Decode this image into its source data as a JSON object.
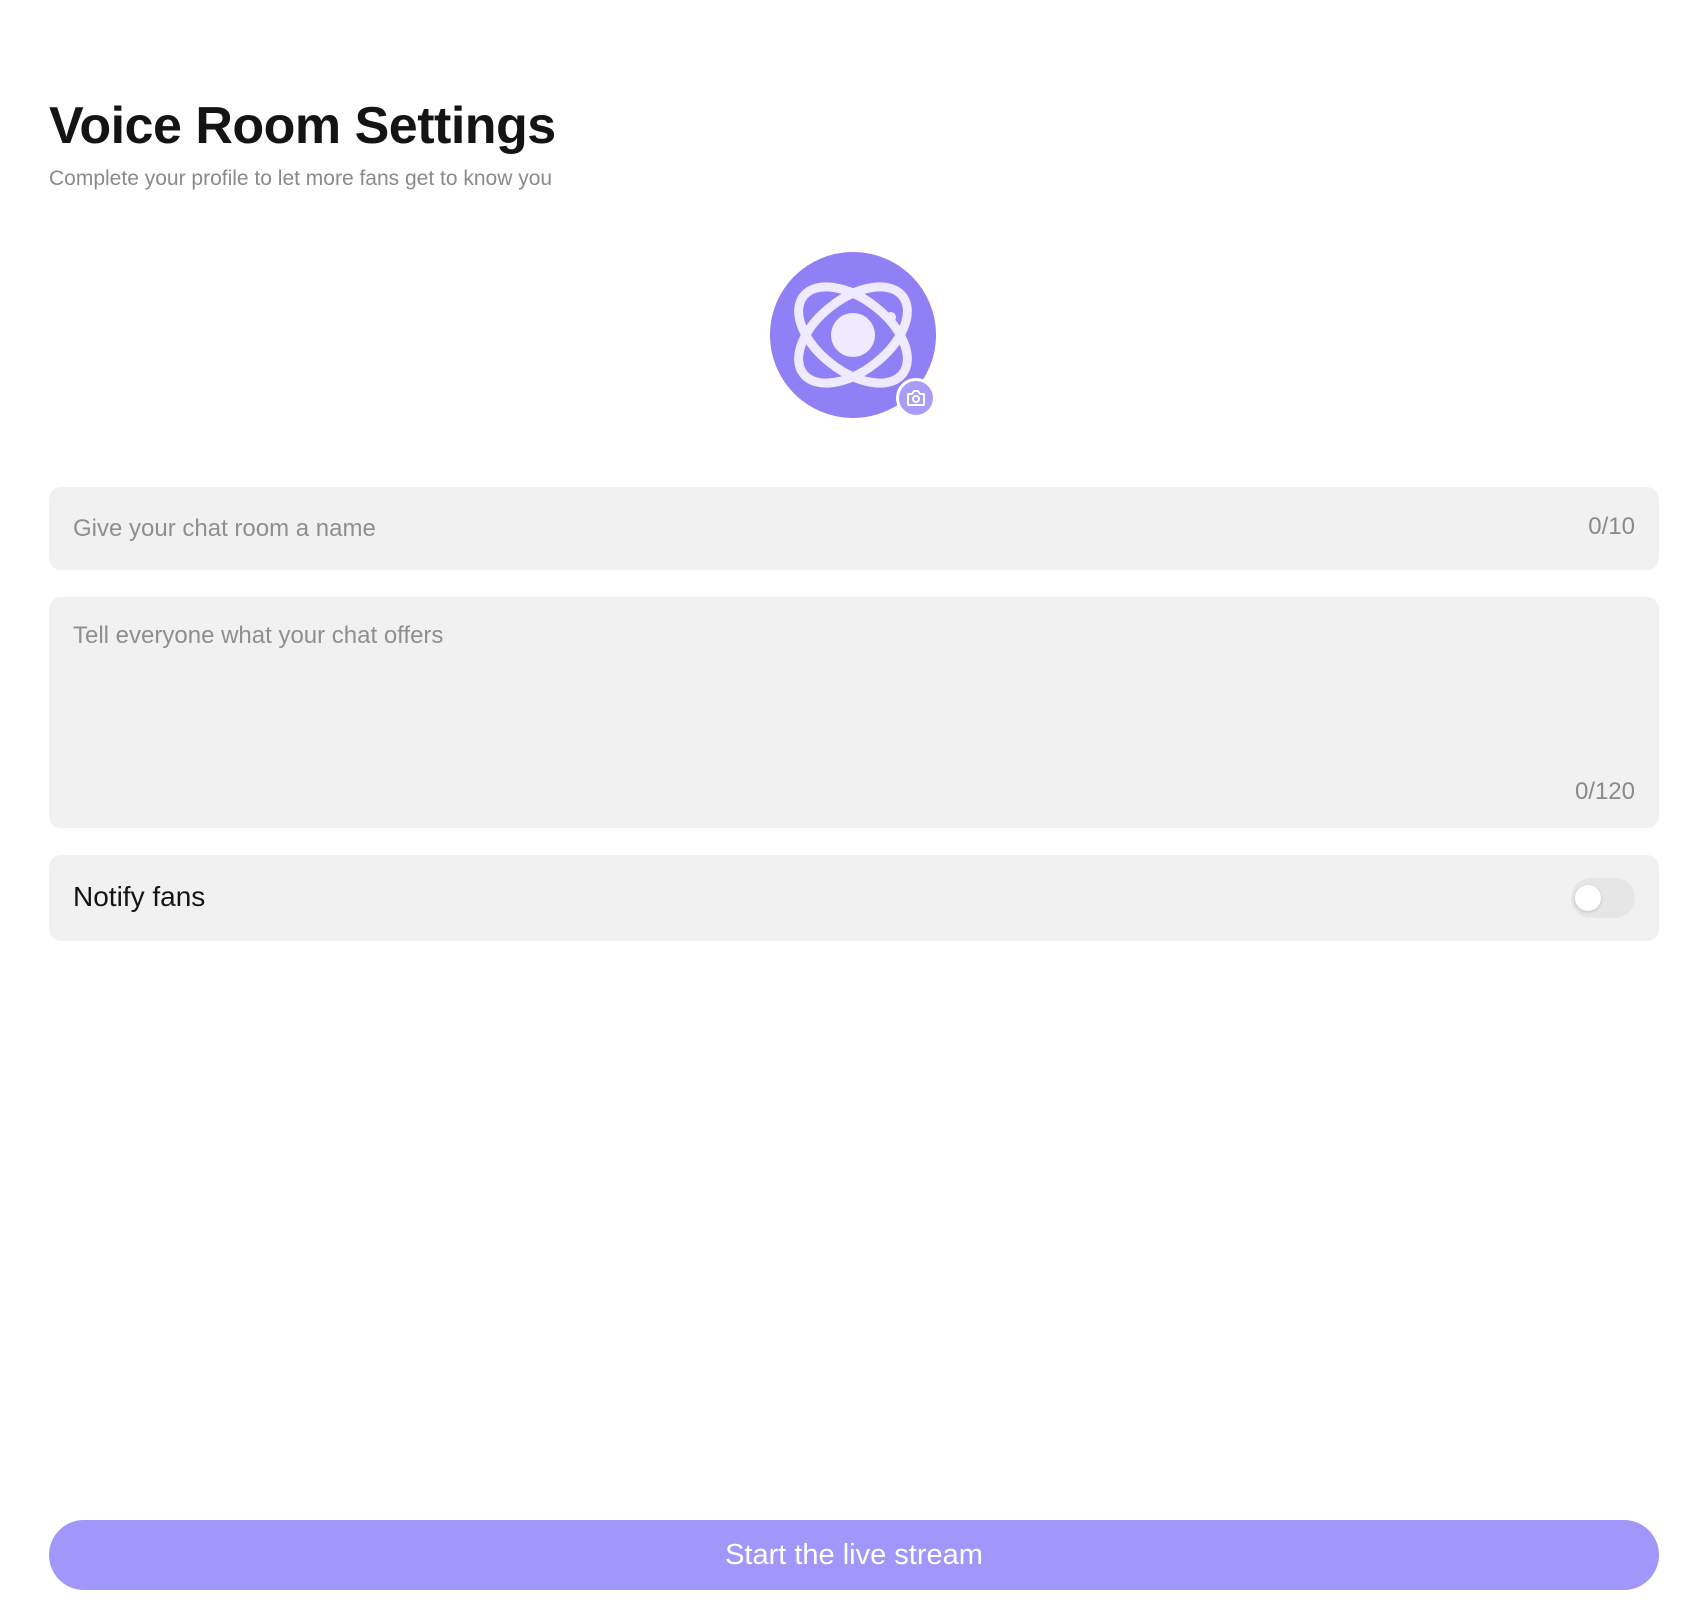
{
  "header": {
    "title": "Voice Room Settings",
    "subtitle": "Complete your profile to let more fans get to know you"
  },
  "avatar": {
    "icon": "planet-orbit-icon",
    "badge_icon": "camera-icon",
    "color": "#8f80f5"
  },
  "form": {
    "name": {
      "value": "",
      "placeholder": "Give your chat room a name",
      "counter": "0/10"
    },
    "description": {
      "value": "",
      "placeholder": "Tell everyone what your chat offers",
      "counter": "0/120"
    },
    "notify": {
      "label": "Notify fans",
      "enabled": false
    }
  },
  "actions": {
    "start_label": "Start the live stream",
    "button_color": "#a197fa"
  }
}
